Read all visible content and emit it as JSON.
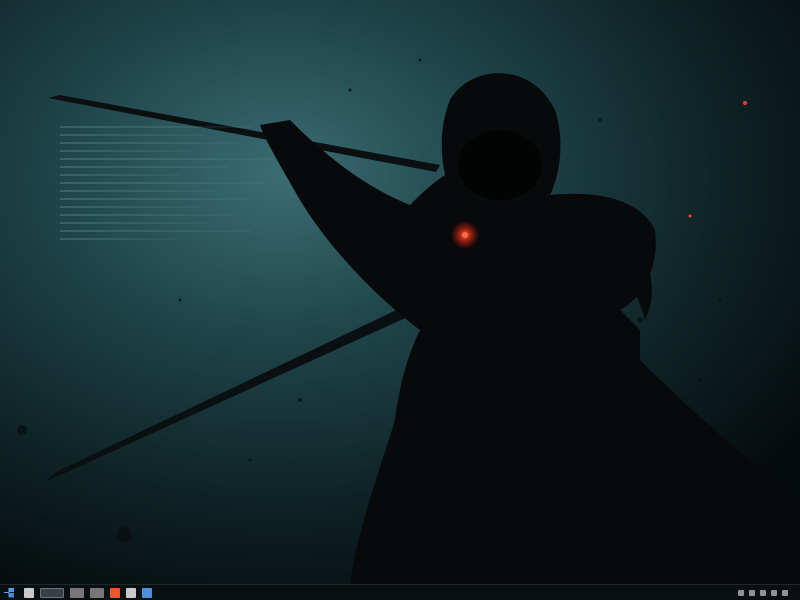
{
  "window": {
    "title": ""
  },
  "desktop": {
    "wallpaper_icon": "hooded-reaper-wallpaper-icon",
    "accent_color": "#ff3a2a"
  },
  "taskbar": {
    "background": "#0a0f11",
    "clock_text": "",
    "icons": [
      "start-icon",
      "file-explorer-icon",
      "app-icon",
      "window-preview-icon",
      "app-icon",
      "browser-icon",
      "app-icon",
      "app-icon"
    ]
  }
}
